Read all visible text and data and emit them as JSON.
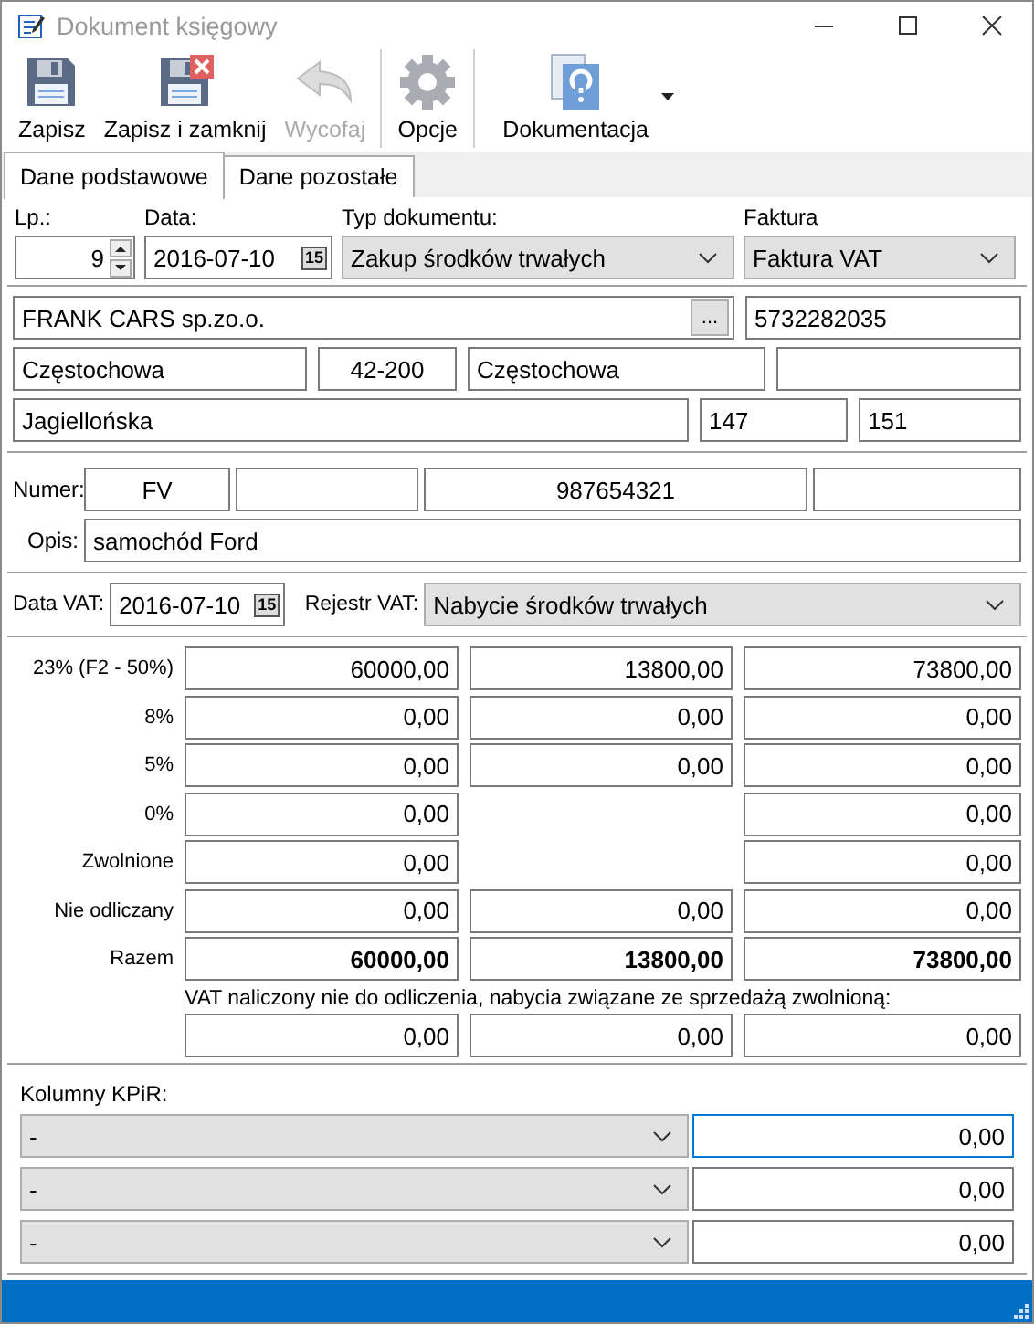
{
  "window": {
    "title": "Dokument księgowy"
  },
  "toolbar": [
    {
      "label": "Zapisz",
      "kind": "save",
      "disabled": false
    },
    {
      "label": "Zapisz i zamknij",
      "kind": "save-close",
      "disabled": false
    },
    {
      "label": "Wycofaj",
      "kind": "undo",
      "disabled": true
    },
    {
      "label": "Opcje",
      "kind": "options",
      "disabled": false,
      "separator_before": true
    },
    {
      "label": "Dokumentacja",
      "kind": "help",
      "disabled": false,
      "separator_before": true,
      "dropdown": true
    }
  ],
  "tabs": [
    {
      "label": "Dane podstawowe",
      "selected": true
    },
    {
      "label": "Dane pozostałe",
      "selected": false
    }
  ],
  "header": {
    "lp": {
      "label": "Lp.:",
      "value": "9"
    },
    "date": {
      "label": "Data:",
      "value": "2016-07-10",
      "calendar": "15"
    },
    "doc_type": {
      "label": "Typ dokumentu:",
      "value": "Zakup środków trwałych"
    },
    "invoice": {
      "label": "Faktura",
      "value": "Faktura VAT"
    }
  },
  "contractor": {
    "name": "FRANK CARS sp.zo.o.",
    "browse": "...",
    "nip": "5732282035",
    "city": "Częstochowa",
    "postal_code": "42-200",
    "post_office": "Częstochowa",
    "street": "Jagiellońska",
    "house": "147",
    "flat": "151"
  },
  "number": {
    "label": "Numer:",
    "series": "FV",
    "number": "987654321"
  },
  "description": {
    "label": "Opis:",
    "value": "samochód Ford"
  },
  "vat": {
    "date_label": "Data VAT:",
    "date": "2016-07-10",
    "calendar": "15",
    "register_label": "Rejestr VAT:",
    "register": "Nabycie środków trwałych"
  },
  "vat_rows": [
    {
      "label": "23% (F2 - 50%)",
      "net": "60000,00",
      "vat": "13800,00",
      "gross": "73800,00"
    },
    {
      "label": "8%",
      "net": "0,00",
      "vat": "0,00",
      "gross": "0,00"
    },
    {
      "label": "5%",
      "net": "0,00",
      "vat": "0,00",
      "gross": "0,00"
    },
    {
      "label": "0%",
      "net": "0,00",
      "gross": "0,00"
    },
    {
      "label": "Zwolnione",
      "net": "0,00",
      "gross": "0,00"
    },
    {
      "label": "Nie odliczany",
      "net": "0,00",
      "vat": "0,00",
      "gross": "0,00"
    },
    {
      "label": "Razem",
      "net": "60000,00",
      "vat": "13800,00",
      "gross": "73800,00",
      "kind": "total"
    }
  ],
  "exempt_note": {
    "text": "VAT naliczony nie do odliczenia, nabycia związane ze sprzedażą zwolnioną:",
    "net": "0,00",
    "vat": "0,00",
    "gross": "0,00"
  },
  "kpir": {
    "label": "Kolumny KPiR:",
    "rows": [
      {
        "column": "-",
        "amount": "0,00",
        "focused": true
      },
      {
        "column": "-",
        "amount": "0,00",
        "focused": false
      },
      {
        "column": "-",
        "amount": "0,00",
        "focused": false
      }
    ]
  }
}
